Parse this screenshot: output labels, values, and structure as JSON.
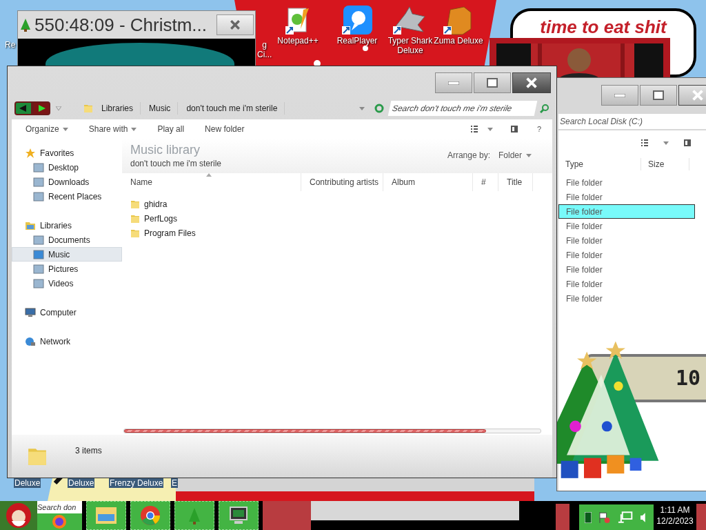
{
  "desktop": {
    "icons": [
      {
        "lines": [
          "Re"
        ]
      },
      {
        "lines": [
          "g",
          "Ci..."
        ]
      },
      {
        "lines": [
          "Notepad++"
        ]
      },
      {
        "lines": [
          "RealPlayer"
        ]
      },
      {
        "lines": [
          "Typer Shark",
          "Deluxe"
        ]
      },
      {
        "lines": [
          "Zuma Deluxe"
        ]
      }
    ],
    "bottom_labels": [
      "Deluxe",
      "Deluxe",
      "Frenzy Deluxe",
      "E"
    ],
    "speech_bubble": {
      "text": "time to eat shit"
    },
    "clock_gadget": {
      "text": "10"
    }
  },
  "timer_window": {
    "title": "550:48:09 - Christm..."
  },
  "back_window": {
    "search": {
      "placeholder": "Search Local Disk (C:)"
    },
    "columns": [
      "Type",
      "Size"
    ],
    "rows": [
      {
        "type": "File folder",
        "selected": false
      },
      {
        "type": "File folder",
        "selected": false
      },
      {
        "type": "File folder",
        "selected": true
      },
      {
        "type": "File folder",
        "selected": false
      },
      {
        "type": "File folder",
        "selected": false
      },
      {
        "type": "File folder",
        "selected": false
      },
      {
        "type": "File folder",
        "selected": false
      },
      {
        "type": "File folder",
        "selected": false
      },
      {
        "type": "File folder",
        "selected": false
      }
    ]
  },
  "main_window": {
    "breadcrumb": [
      "Libraries",
      "Music",
      "don't touch me i'm sterile"
    ],
    "search": {
      "placeholder": "Search don't touch me i'm sterile"
    },
    "toolbar": [
      {
        "label": "Organize",
        "dropdown": true
      },
      {
        "label": "Share with",
        "dropdown": true
      },
      {
        "label": "Play all",
        "dropdown": false
      },
      {
        "label": "New folder",
        "dropdown": false
      }
    ],
    "help": "?",
    "navigation": [
      {
        "label": "Favorites",
        "selected": false,
        "children": [
          {
            "label": "Desktop",
            "selected": false
          },
          {
            "label": "Downloads",
            "selected": false
          },
          {
            "label": "Recent Places",
            "selected": false
          }
        ]
      },
      {
        "label": "Libraries",
        "selected": false,
        "children": [
          {
            "label": "Documents",
            "selected": false
          },
          {
            "label": "Music",
            "selected": true
          },
          {
            "label": "Pictures",
            "selected": false
          },
          {
            "label": "Videos",
            "selected": false
          }
        ]
      },
      {
        "label": "Computer",
        "selected": false
      },
      {
        "label": "Network",
        "selected": false
      }
    ],
    "library": {
      "title": "Music library",
      "subtitle": "don't touch me i'm sterile",
      "arrange_label": "Arrange by:",
      "arrange_value": "Folder"
    },
    "columns": [
      "Name",
      "Contributing artists",
      "Album",
      "#",
      "Title"
    ],
    "files": [
      "ghidra",
      "PerfLogs",
      "Program Files"
    ],
    "progress": {
      "level": 0.87
    },
    "status": "3 items"
  },
  "taskbar": {
    "search": {
      "placeholder": "Search don"
    },
    "clock": {
      "time": "1:11 AM",
      "date": "12/2/2023"
    }
  }
}
